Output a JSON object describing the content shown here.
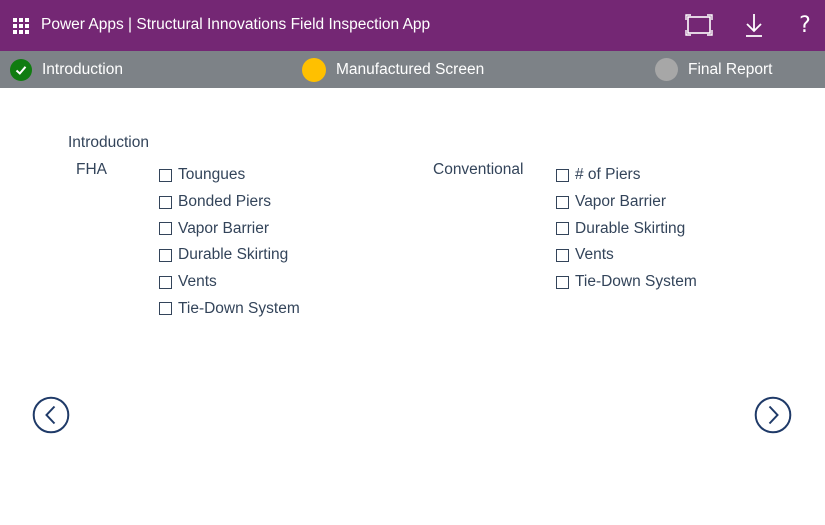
{
  "header": {
    "title": "Power Apps | Structural Innovations Field Inspection App",
    "icons": [
      "waffle-icon",
      "fit-to-window-icon",
      "download-icon",
      "help-icon"
    ],
    "help_glyph": "?",
    "bg_color": "#742774"
  },
  "steps": [
    {
      "label": "Introduction",
      "status": "complete",
      "color": "#107c10"
    },
    {
      "label": "Manufactured Screen",
      "status": "current",
      "color": "#ffc000"
    },
    {
      "label": "Final Report",
      "status": "pending",
      "color": "#a7a7a7"
    }
  ],
  "main": {
    "section_title": "Introduction",
    "groups": [
      {
        "label": "FHA",
        "items": [
          "Toungues",
          "Bonded Piers",
          "Vapor Barrier",
          "Durable Skirting",
          "Vents",
          "Tie-Down System"
        ]
      },
      {
        "label": "Conventional",
        "items": [
          "# of Piers",
          "Vapor Barrier",
          "Durable Skirting",
          "Vents",
          "Tie-Down System"
        ]
      }
    ]
  },
  "navigation": {
    "back_icon": "chevron-left-circle-icon",
    "next_icon": "chevron-right-circle-icon",
    "color": "#1f3a68"
  }
}
